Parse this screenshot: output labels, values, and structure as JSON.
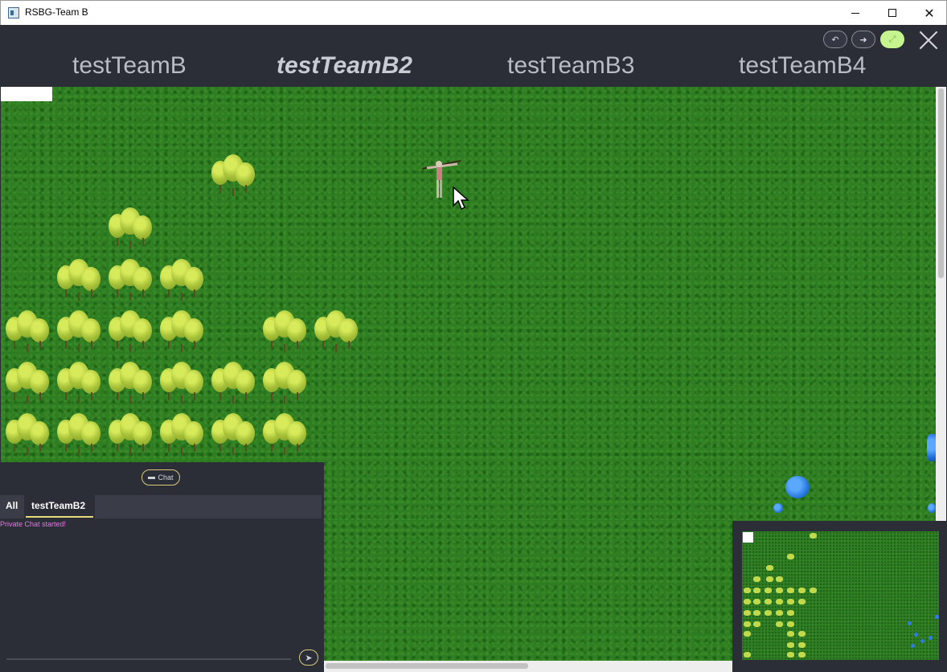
{
  "window": {
    "title": "RSBG-Team B"
  },
  "header": {
    "teams": [
      {
        "label": "testTeamB",
        "active": false
      },
      {
        "label": "testTeamB2",
        "active": true
      },
      {
        "label": "testTeamB3",
        "active": false
      },
      {
        "label": "testTeamB4",
        "active": false
      }
    ],
    "controls": [
      "undo-icon",
      "redo-icon",
      "expand-icon",
      "close-icon"
    ]
  },
  "chat": {
    "toggle_label": "Chat",
    "tabs": [
      {
        "label": "All",
        "active": false
      },
      {
        "label": "testTeamB2",
        "active": true
      }
    ],
    "messages": [
      "Private Chat started!"
    ],
    "message_color": "#e277e2",
    "accent": "#e9d97a"
  },
  "colors": {
    "background": "#2b2e37",
    "grass": "#2e7d22",
    "tree": "#b5cf3f",
    "water": "#1e6fd8"
  }
}
